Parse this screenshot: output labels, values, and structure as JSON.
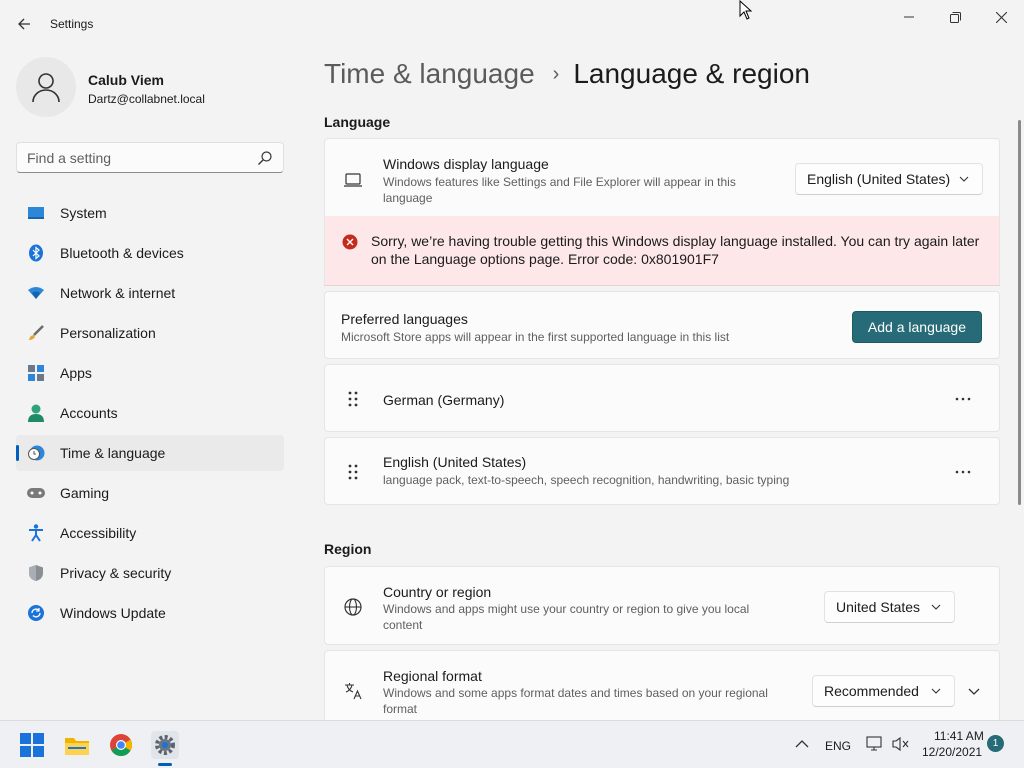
{
  "window": {
    "app_title": "Settings",
    "colors": {
      "accent": "#005fb8",
      "button": "#266b77",
      "error_bg": "#fde7e9",
      "error_icon": "#c42b1c"
    }
  },
  "user": {
    "name": "Calub Viem",
    "email": "Dartz@collabnet.local"
  },
  "search": {
    "placeholder": "Find a setting",
    "value": ""
  },
  "sidebar": {
    "items": [
      {
        "label": "System",
        "icon": "monitor-icon"
      },
      {
        "label": "Bluetooth & devices",
        "icon": "bluetooth-icon"
      },
      {
        "label": "Network & internet",
        "icon": "wifi-icon"
      },
      {
        "label": "Personalization",
        "icon": "brush-icon"
      },
      {
        "label": "Apps",
        "icon": "apps-icon"
      },
      {
        "label": "Accounts",
        "icon": "person-icon"
      },
      {
        "label": "Time & language",
        "icon": "clock-globe-icon",
        "active": true
      },
      {
        "label": "Gaming",
        "icon": "gamepad-icon"
      },
      {
        "label": "Accessibility",
        "icon": "accessibility-icon"
      },
      {
        "label": "Privacy & security",
        "icon": "shield-icon"
      },
      {
        "label": "Windows Update",
        "icon": "update-icon"
      }
    ]
  },
  "header": {
    "parent": "Time & language",
    "separator": "›",
    "current": "Language & region"
  },
  "language": {
    "section_title": "Language",
    "display_language": {
      "title": "Windows display language",
      "description": "Windows features like Settings and File Explorer will appear in this language",
      "selected": "English (United States)"
    },
    "error_message": "Sorry, we’re having trouble getting this Windows display language installed. You can try again later on the Language options page. Error code: 0x801901F7",
    "preferred": {
      "title": "Preferred languages",
      "description": "Microsoft Store apps will appear in the first supported language in this list",
      "add_button": "Add a language"
    },
    "languages": [
      {
        "name": "German (Germany)",
        "details": ""
      },
      {
        "name": "English (United States)",
        "details": "language pack, text-to-speech, speech recognition, handwriting, basic typing"
      }
    ],
    "more_label": "···"
  },
  "region": {
    "section_title": "Region",
    "country": {
      "title": "Country or region",
      "description": "Windows and apps might use your country or region to give you local content",
      "selected": "United States"
    },
    "format": {
      "title": "Regional format",
      "description": "Windows and some apps format dates and times based on your regional format",
      "selected": "Recommended"
    }
  },
  "taskbar": {
    "language": "ENG",
    "time": "11:41 AM",
    "date": "12/20/2021",
    "notification_count": "1"
  }
}
